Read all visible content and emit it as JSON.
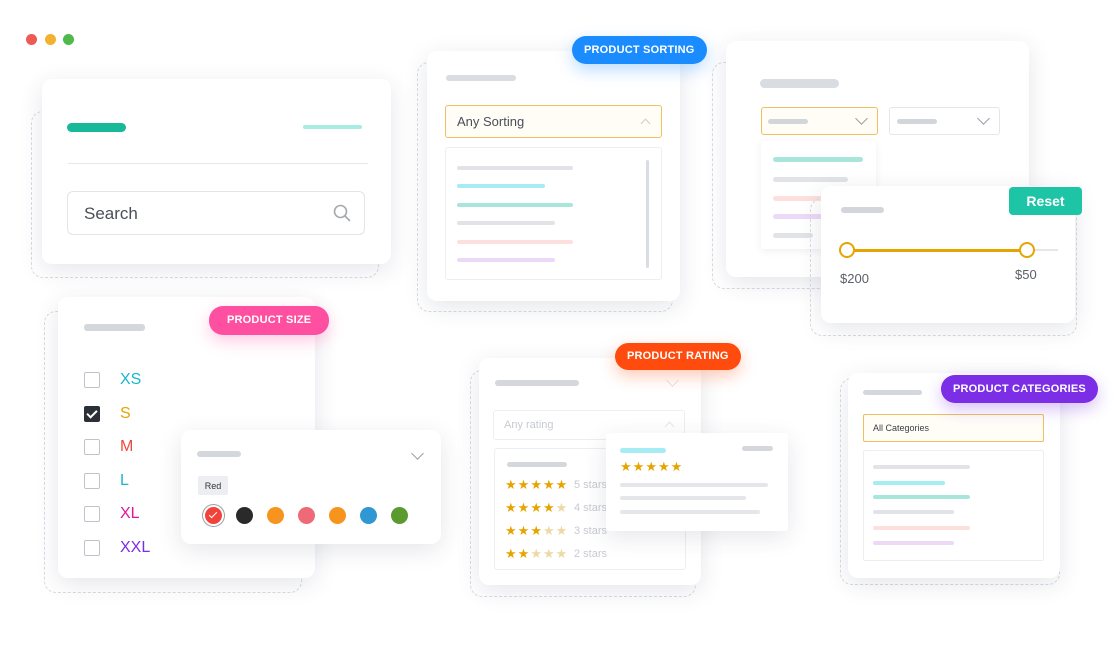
{
  "window": {
    "dots": [
      "#ee5b55",
      "#f2b230",
      "#4fba49"
    ]
  },
  "search": {
    "placeholder": "Search",
    "icon": "search-icon"
  },
  "sorting": {
    "badge": "PRODUCT SORTING",
    "badge_color": "#1a8cff",
    "selected": "Any Sorting"
  },
  "price": {
    "reset_label": "Reset",
    "reset_color": "#1ec4a6",
    "min_label": "$200",
    "max_label": "$50",
    "accent": "#e6a400"
  },
  "size": {
    "badge": "PRODUCT SIZE",
    "badge_color": "#ff4fa0",
    "options": [
      {
        "label": "XS",
        "color": "#17b8cf",
        "checked": false
      },
      {
        "label": "S",
        "color": "#e6a400",
        "checked": true
      },
      {
        "label": "M",
        "color": "#ef4a3f",
        "checked": false
      },
      {
        "label": "L",
        "color": "#17b8cf",
        "checked": false
      },
      {
        "label": "XL",
        "color": "#e5159a",
        "checked": false
      },
      {
        "label": "XXL",
        "color": "#7b2ee6",
        "checked": false
      }
    ]
  },
  "color": {
    "tooltip": "Red",
    "swatches": [
      "#f0433a",
      "#2a2a2a",
      "#f7941d",
      "#ee6a77",
      "#f7941d",
      "#2f97d1",
      "#5b9a2f"
    ],
    "selected_index": 0
  },
  "rating": {
    "badge": "PRODUCT RATING",
    "badge_color": "#ff4b0e",
    "placeholder": "Any rating",
    "rows": [
      {
        "stars": 5,
        "label": "5 stars"
      },
      {
        "stars": 4,
        "label": "4 stars"
      },
      {
        "stars": 3,
        "label": "3 stars"
      },
      {
        "stars": 2,
        "label": "2 stars"
      }
    ],
    "popup_stars": 5
  },
  "categories": {
    "badge": "PRODUCT CATEGORIES",
    "badge_color": "#7b2ee6",
    "selected": "All Categories"
  }
}
